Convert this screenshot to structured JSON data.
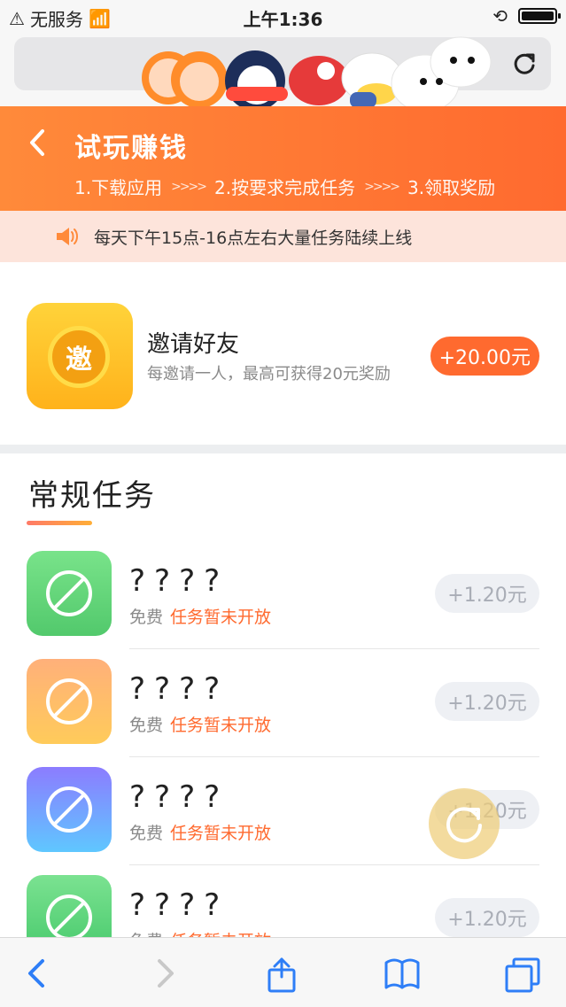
{
  "statusbar": {
    "carrier": "无服务",
    "time": "上午1:36"
  },
  "hero": {
    "title": "试玩赚钱",
    "steps": [
      "1.下载应用",
      "2.按要求完成任务",
      "3.领取奖励"
    ],
    "chevrons": ">>>>"
  },
  "notice": {
    "text": "每天下午15点-16点左右大量任务陆续上线"
  },
  "invite": {
    "icon_char": "邀",
    "name": "邀请好友",
    "desc": "每邀请一人，最高可获得20元奖励",
    "price": "+20.00元"
  },
  "section": {
    "title": "常规任务"
  },
  "tasks": [
    {
      "name": "????",
      "free": "免费",
      "status": "任务暂未开放",
      "price": "+1.20元",
      "colors": [
        "#79e38a",
        "#52c96c"
      ]
    },
    {
      "name": "????",
      "free": "免费",
      "status": "任务暂未开放",
      "price": "+1.20元",
      "colors": [
        "#ffb07a",
        "#ffcb5a"
      ]
    },
    {
      "name": "????",
      "free": "免费",
      "status": "任务暂未开放",
      "price": "+1.20元",
      "colors": [
        "#8c7cff",
        "#5fc7ff"
      ]
    },
    {
      "name": "????",
      "free": "免费",
      "status": "任务暂未开放",
      "price": "+1.20元",
      "colors": [
        "#7be291",
        "#45c86a"
      ]
    }
  ]
}
